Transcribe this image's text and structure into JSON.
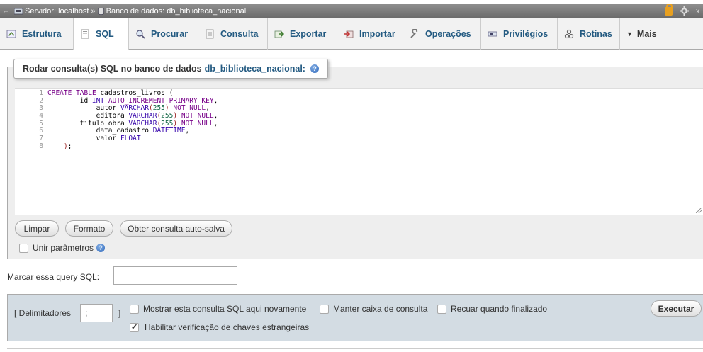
{
  "topbar": {
    "back_glyph": "←",
    "server_label": "Servidor: localhost",
    "separator": "»",
    "database_label": "Banco de dados: db_biblioteca_nacional"
  },
  "tabs": [
    {
      "label": "Estrutura",
      "icon": "structure-icon",
      "active": false
    },
    {
      "label": "SQL",
      "icon": "sql-icon",
      "active": true
    },
    {
      "label": "Procurar",
      "icon": "search-icon",
      "active": false
    },
    {
      "label": "Consulta",
      "icon": "query-icon",
      "active": false
    },
    {
      "label": "Exportar",
      "icon": "export-icon",
      "active": false
    },
    {
      "label": "Importar",
      "icon": "import-icon",
      "active": false
    },
    {
      "label": "Operações",
      "icon": "wrench-icon",
      "active": false
    },
    {
      "label": "Privilégios",
      "icon": "privileges-icon",
      "active": false
    },
    {
      "label": "Rotinas",
      "icon": "routines-icon",
      "active": false
    },
    {
      "label": "Mais",
      "icon": "dropdown-triangle-icon",
      "active": false
    }
  ],
  "legend": {
    "text": "Rodar consulta(s) SQL no banco de dados",
    "database": "db_biblioteca_nacional:"
  },
  "editor": {
    "line_numbers": [
      "1",
      "2",
      "3",
      "4",
      "5",
      "6",
      "7",
      "8"
    ]
  },
  "buttons": {
    "clear": "Limpar",
    "format": "Formato",
    "autosave": "Obter consulta auto-salva"
  },
  "bind_params": {
    "label": "Unir parâmetros",
    "checked": false
  },
  "bookmark": {
    "label": "Marcar essa query SQL:",
    "value": ""
  },
  "delimiter": {
    "label_open": "[ Delimitadores",
    "value": ";",
    "label_close": "]"
  },
  "options": [
    {
      "label": "Mostrar esta consulta SQL aqui novamente",
      "checked": false
    },
    {
      "label": "Manter caixa de consulta",
      "checked": false
    },
    {
      "label": "Recuar quando finalizado",
      "checked": false
    },
    {
      "label": "Habilitar verificação de chaves estrangeiras",
      "checked": true
    }
  ],
  "execute_button": "Executar",
  "colors": {
    "link_blue": "#235a81",
    "panel_bg": "#d3dce3",
    "topbar_bg": "#7a7a7a"
  }
}
